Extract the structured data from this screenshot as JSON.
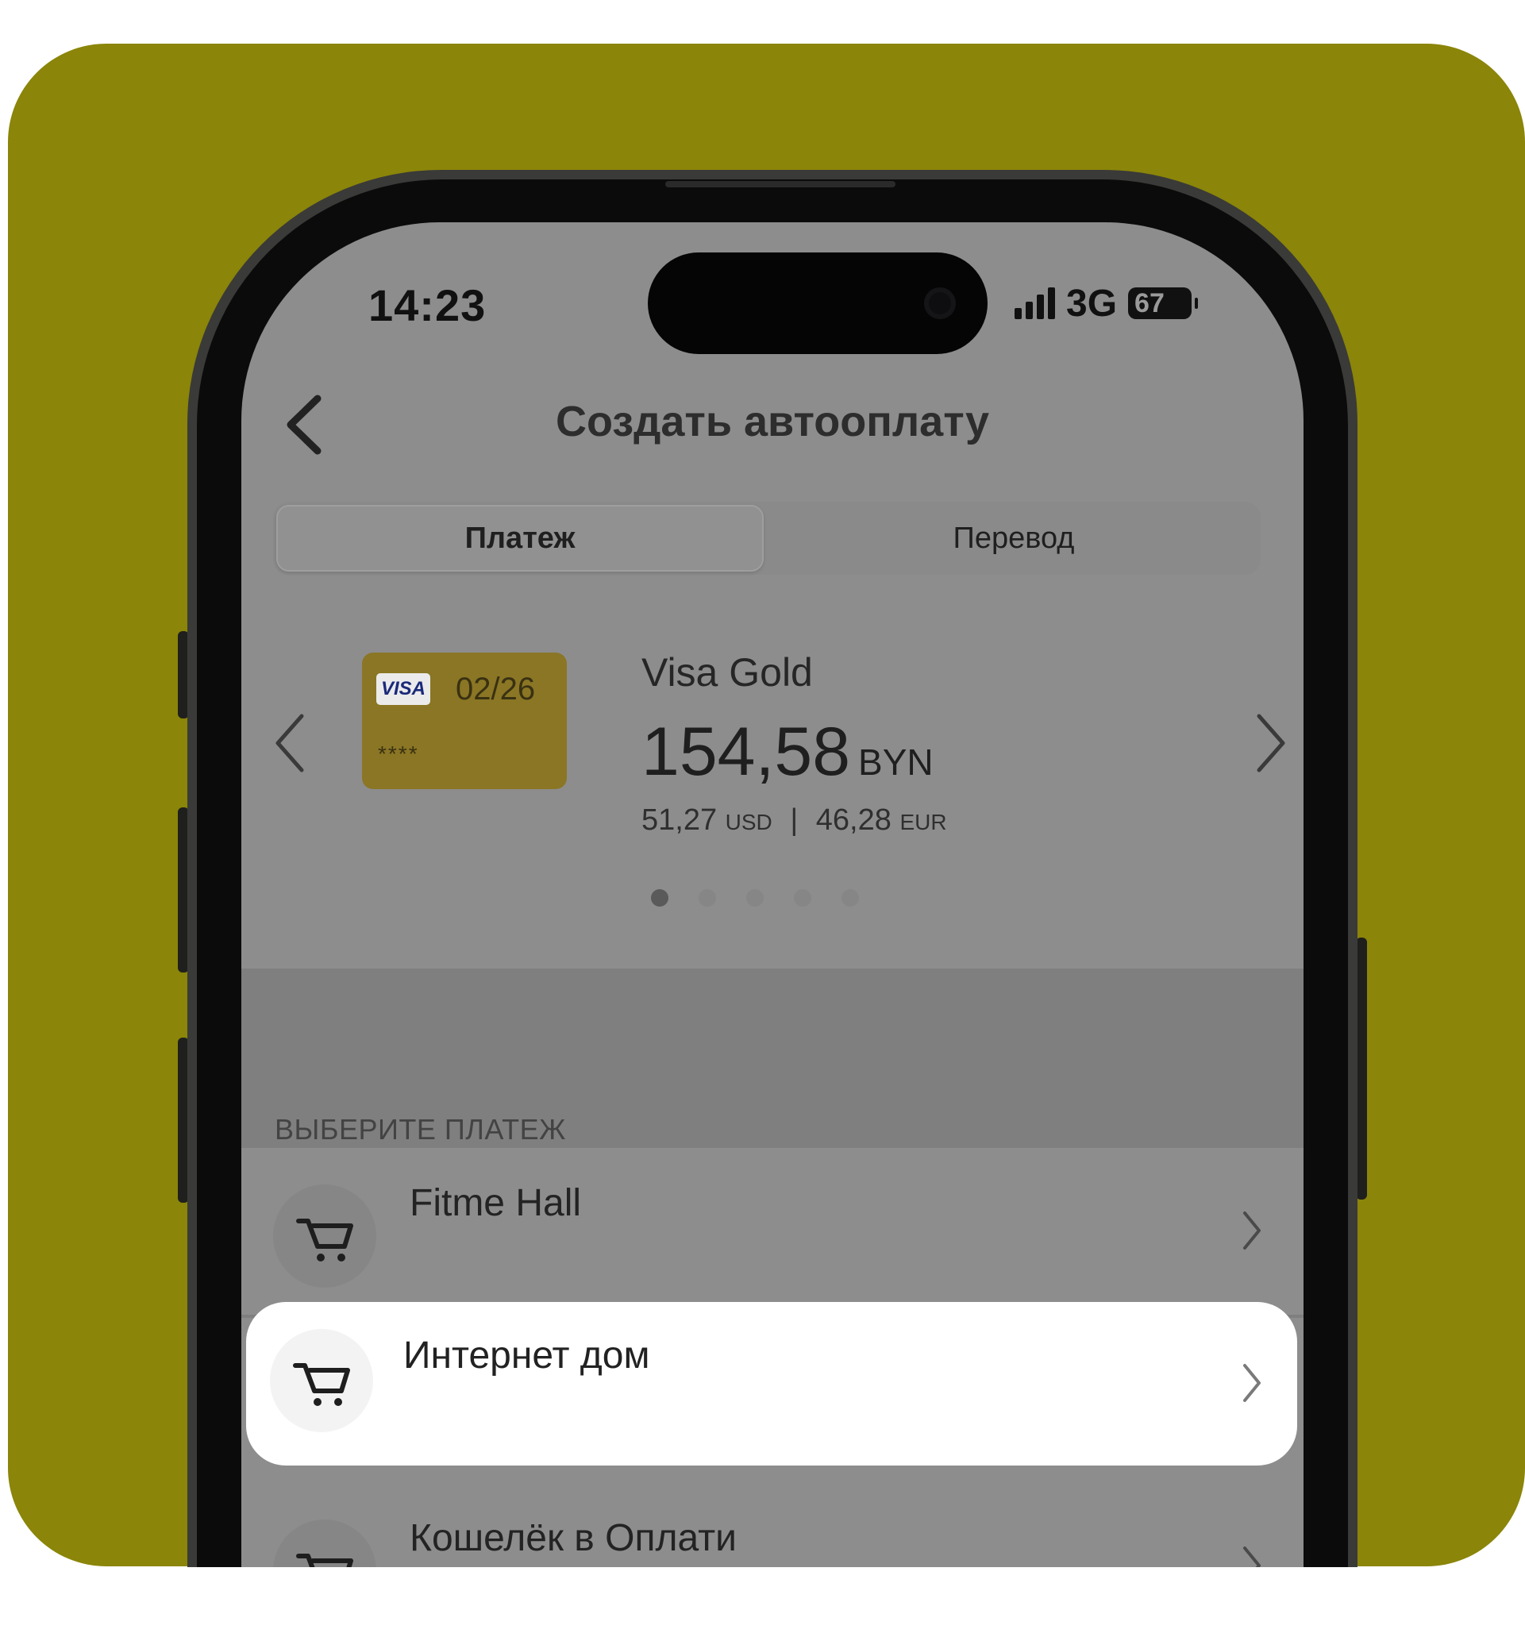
{
  "status_bar": {
    "time": "14:23",
    "network": "3G",
    "battery": "67"
  },
  "header": {
    "title": "Создать автооплату"
  },
  "tabs": [
    {
      "label": "Платеж",
      "active": true
    },
    {
      "label": "Перевод",
      "active": false
    }
  ],
  "card": {
    "brand": "VISA",
    "expiry": "02/26",
    "mask": "****",
    "name": "Visa Gold",
    "balance": "154,58",
    "currency": "BYN",
    "usd_value": "51,27",
    "usd_label": "USD",
    "separator": "|",
    "eur_value": "46,28",
    "eur_label": "EUR",
    "pages_total": 5,
    "page_active": 1
  },
  "section": {
    "label": "ВЫБЕРИТЕ ПЛАТЕЖ"
  },
  "payments": [
    {
      "label": "Fitme Hall",
      "icon": "cart-icon"
    },
    {
      "label": "Интернет дом",
      "icon": "cart-icon",
      "highlighted": true
    },
    {
      "label": "Кошелёк в Оплати",
      "icon": "cart-icon"
    }
  ],
  "colors": {
    "background": "#8b8509",
    "highlight": "#ffffff",
    "card": "#8a7624"
  }
}
